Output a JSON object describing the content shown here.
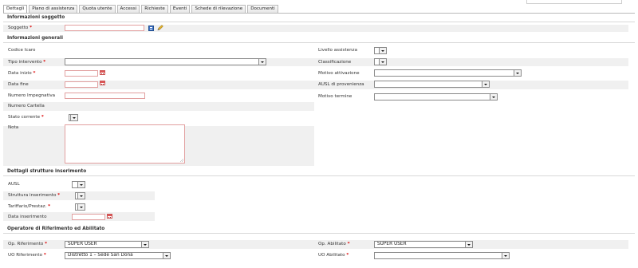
{
  "tabs": [
    "Dettagli",
    "Piano di assistenza",
    "Quota utente",
    "Accessi",
    "Richieste",
    "Eventi",
    "Schede di rilevazione",
    "Documenti"
  ],
  "sections": {
    "soggetto": "Informazioni soggetto",
    "generali": "Informazioni generali",
    "strutture": "Dettagli strutture inserimento",
    "operatore": "Operatore di Riferimento ed Abilitato"
  },
  "required_mark": "*",
  "soggetto": {
    "label": "Soggetto"
  },
  "left": {
    "codice_icaro": "Codice Icaro",
    "tipo_intervento": "Tipo intervento",
    "data_inizio": "Data inizio",
    "data_fine": "Data fine",
    "numero_impegnativa": "Numero Impegnativa",
    "numero_cartella": "Numero Cartella",
    "stato_corrente": "Stato corrente",
    "nota": "Nota"
  },
  "right": {
    "livello_assistenza": "Livello assistenza",
    "classificazione": "Classificazione",
    "motivo_attivazione": "Motivo attivazione",
    "ausl_provenienza": "AUSL di provenienza",
    "motivo_termine": "Motivo termine"
  },
  "strutture": {
    "ausl": "AUSL",
    "struttura": "Struttura inserimento",
    "tariffario": "Tariffario/Prestaz.",
    "data_inserimento": "Data inserimento"
  },
  "operatore": {
    "op_riferimento": "Op. Riferimento",
    "op_riferimento_value": "SUPER USER",
    "uo_riferimento": "UO Riferimento",
    "uo_riferimento_value": "Distretto 1 – Sede San Donà",
    "op_abilitato": "Op. Abilitato",
    "op_abilitato_value": "SUPER USER",
    "uo_abilitato": "UO Abilitato"
  }
}
